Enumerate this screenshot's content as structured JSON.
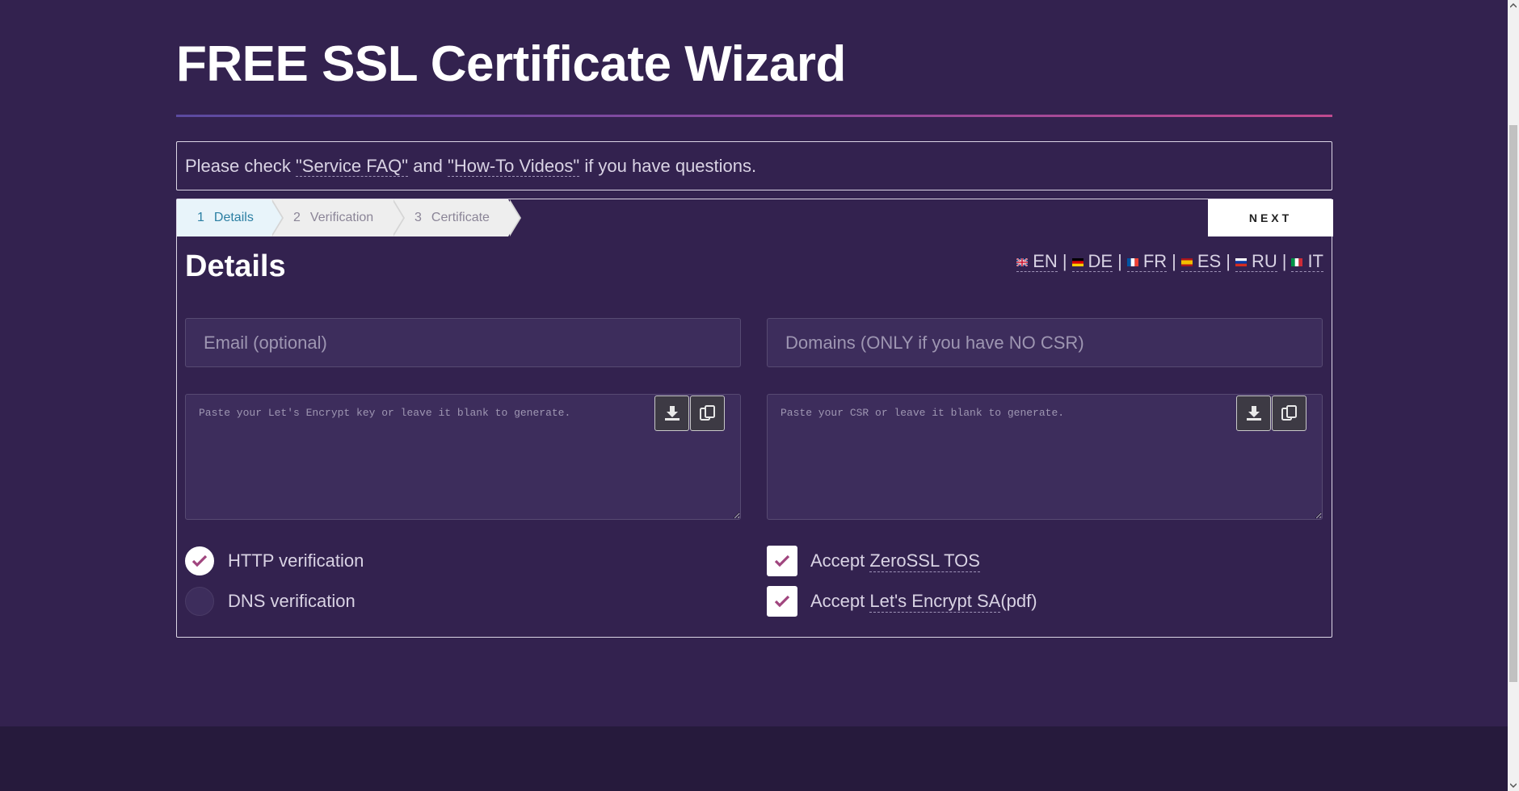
{
  "page": {
    "title": "FREE SSL Certificate Wizard"
  },
  "notice": {
    "prefix": "Please check ",
    "faq_link": "\"Service FAQ\"",
    "and": " and ",
    "videos_link": "\"How-To Videos\"",
    "suffix": " if you have questions."
  },
  "steps": [
    {
      "num": "1",
      "label": "Details",
      "active": true
    },
    {
      "num": "2",
      "label": "Verification",
      "active": false
    },
    {
      "num": "3",
      "label": "Certificate",
      "active": false
    }
  ],
  "next_label": "NEXT",
  "section_title": "Details",
  "languages": [
    {
      "code": "EN",
      "flag": "uk-flag-icon"
    },
    {
      "code": "DE",
      "flag": "germany-flag-icon"
    },
    {
      "code": "FR",
      "flag": "france-flag-icon"
    },
    {
      "code": "ES",
      "flag": "spain-flag-icon"
    },
    {
      "code": "RU",
      "flag": "russia-flag-icon"
    },
    {
      "code": "IT",
      "flag": "italy-flag-icon"
    }
  ],
  "language_separator": "|",
  "form": {
    "email": {
      "value": "",
      "placeholder": "Email (optional)"
    },
    "domains": {
      "value": "",
      "placeholder": "Domains (ONLY if you have NO CSR)"
    },
    "key": {
      "value": "",
      "placeholder": "Paste your Let's Encrypt key or leave it blank to generate."
    },
    "csr": {
      "value": "",
      "placeholder": "Paste your CSR or leave it blank to generate."
    }
  },
  "verification": {
    "http": {
      "label": "HTTP verification",
      "checked": true
    },
    "dns": {
      "label": "DNS verification",
      "checked": false
    }
  },
  "terms": {
    "tos": {
      "prefix": "Accept ",
      "link": "ZeroSSL TOS",
      "suffix": "",
      "checked": true
    },
    "sa": {
      "prefix": "Accept ",
      "link": "Let's Encrypt SA",
      "suffix": " (pdf)",
      "checked": true
    }
  },
  "colors": {
    "background": "#33224f",
    "accent_check": "#a0457e",
    "active_step": "#2b7fa3"
  },
  "icons": {
    "download": "download-icon",
    "copy": "copy-icon",
    "check": "check-icon"
  }
}
